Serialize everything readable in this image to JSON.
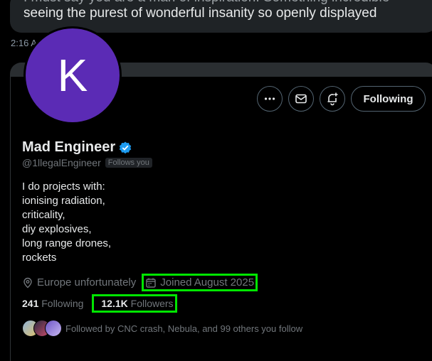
{
  "background": {
    "message_line_top": "I must say you are a man of inspiration. Something incredible",
    "message_line": "seeing the purest of wonderful insanity so openly displayed",
    "timestamp": "2:16 A"
  },
  "profile": {
    "avatar_letter": "K",
    "avatar_color": "#5b2bb5",
    "display_name": "Mad Engineer",
    "verified_icon": "verified-badge-icon",
    "handle": "@1llegalEngineer",
    "follows_you_label": "Follows you",
    "bio_lines": [
      "I do projects with:",
      "ionising radiation,",
      "criticality,",
      "diy explosives,",
      "long range drones,",
      "rockets"
    ],
    "location": "Europe unfortunately",
    "joined": "Joined August 2025",
    "following_count": "241",
    "following_label": "Following",
    "followers_count": "12.1K",
    "followers_label": "Followers",
    "followed_by": "Followed by CNC crash, Nebula, and 99 others you follow"
  },
  "actions": {
    "more_icon": "more-icon",
    "message_icon": "envelope-icon",
    "notify_icon": "bell-plus-icon",
    "follow_button_label": "Following"
  },
  "colors": {
    "highlight": "#00e600",
    "verified": "#1d9bf0"
  }
}
